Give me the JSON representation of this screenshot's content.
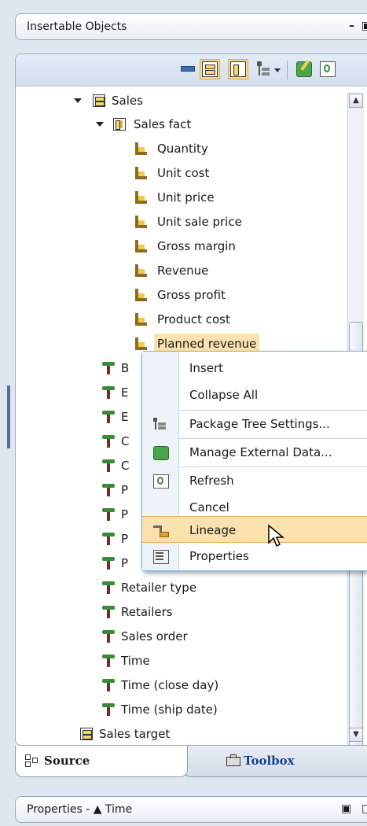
{
  "panel": {
    "title": "Insertable Objects",
    "controls": "– ▣"
  },
  "tree": {
    "rows": [
      {
        "label": "Sales",
        "icon": "namespace-icon",
        "expander": "expanded"
      },
      {
        "label": "Sales fact",
        "icon": "fact-table-icon",
        "expander": "expanded"
      },
      {
        "label": "Quantity",
        "icon": "measure-icon"
      },
      {
        "label": "Unit cost",
        "icon": "measure-icon"
      },
      {
        "label": "Unit price",
        "icon": "measure-icon"
      },
      {
        "label": "Unit sale price",
        "icon": "measure-icon"
      },
      {
        "label": "Gross margin",
        "icon": "measure-icon"
      },
      {
        "label": "Revenue",
        "icon": "measure-icon"
      },
      {
        "label": "Gross profit",
        "icon": "measure-icon"
      },
      {
        "label": "Product cost",
        "icon": "measure-icon"
      },
      {
        "label": "Planned revenue",
        "icon": "measure-icon",
        "selected": true
      },
      {
        "label": "B",
        "icon": "dimension-icon",
        "expander": "collapsed"
      },
      {
        "label": "E",
        "icon": "dimension-icon",
        "expander": "collapsed"
      },
      {
        "label": "E",
        "icon": "dimension-icon",
        "expander": "collapsed"
      },
      {
        "label": "C",
        "icon": "dimension-icon",
        "expander": "collapsed"
      },
      {
        "label": "C",
        "icon": "dimension-icon",
        "expander": "collapsed"
      },
      {
        "label": "P",
        "icon": "dimension-icon",
        "expander": "collapsed"
      },
      {
        "label": "P",
        "icon": "dimension-icon",
        "expander": "collapsed"
      },
      {
        "label": "P",
        "icon": "dimension-icon",
        "expander": "collapsed"
      },
      {
        "label": "P",
        "icon": "dimension-icon",
        "expander": "collapsed"
      },
      {
        "label": "Retailer type",
        "icon": "dimension-icon",
        "expander": "collapsed"
      },
      {
        "label": "Retailers",
        "icon": "dimension-icon",
        "expander": "collapsed"
      },
      {
        "label": "Sales order",
        "icon": "dimension-icon",
        "expander": "collapsed"
      },
      {
        "label": "Time",
        "icon": "dimension-icon",
        "expander": "collapsed"
      },
      {
        "label": "Time (close day)",
        "icon": "dimension-icon",
        "expander": "collapsed"
      },
      {
        "label": "Time (ship date)",
        "icon": "dimension-icon",
        "expander": "collapsed"
      },
      {
        "label": "Sales target",
        "icon": "namespace-icon",
        "expander": "collapsed"
      }
    ]
  },
  "context_menu": {
    "items": [
      {
        "label": "Insert",
        "icon": ""
      },
      {
        "label": "Collapse All",
        "icon": ""
      },
      {
        "label": "Package Tree Settings...",
        "icon": "package-tree-settings-icon"
      },
      {
        "label": "Manage External Data...",
        "icon": "manage-external-data-icon"
      },
      {
        "label": "Refresh",
        "icon": "refresh-icon"
      },
      {
        "label": "Cancel",
        "icon": ""
      },
      {
        "label": "Lineage",
        "icon": "lineage-icon",
        "hovered": true
      },
      {
        "label": "Properties",
        "icon": "properties-icon"
      }
    ]
  },
  "tabs": {
    "source": "Source",
    "toolbox": "Toolbox"
  },
  "properties_panel": {
    "title": "Properties - ▲ Time",
    "controls": "▣ □"
  },
  "colors": {
    "selection": "#fbe2b0",
    "menu_hover": "#fbe1ad",
    "border": "#9aa9bd"
  }
}
